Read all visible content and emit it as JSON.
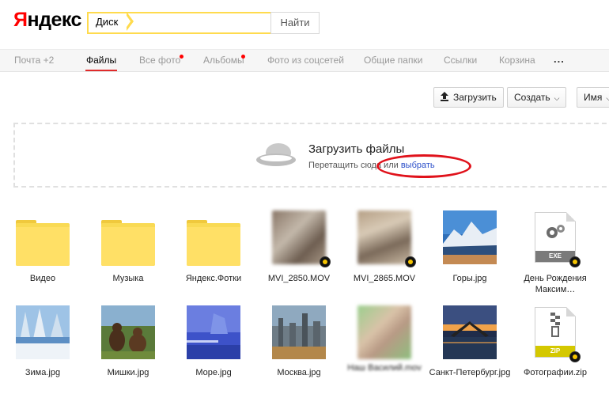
{
  "header": {
    "logo": "Яндекс",
    "search_tag": "Диск",
    "search_value": "",
    "search_button": "Найти"
  },
  "nav": {
    "items": [
      {
        "label": "Почта +2",
        "active": false,
        "dot": false
      },
      {
        "label": "Файлы",
        "active": true,
        "dot": false
      },
      {
        "label": "Все фото",
        "active": false,
        "dot": true
      },
      {
        "label": "Альбомы",
        "active": false,
        "dot": true
      },
      {
        "label": "Фото из соцсетей",
        "active": false,
        "dot": false
      },
      {
        "label": "Общие папки",
        "active": false,
        "dot": false
      },
      {
        "label": "Ссылки",
        "active": false,
        "dot": false
      },
      {
        "label": "Корзина",
        "active": false,
        "dot": false
      }
    ],
    "more": "..."
  },
  "toolbar": {
    "upload_label": "Загрузить",
    "create_label": "Создать",
    "sort_label": "Имя"
  },
  "dropzone": {
    "title": "Загрузить файлы",
    "subtitle_prefix": "Перетащить сюда или ",
    "choose_link": "выбрать"
  },
  "files": [
    {
      "name": "Видео",
      "type": "folder"
    },
    {
      "name": "Музыка",
      "type": "folder"
    },
    {
      "name": "Яндекс.Фотки",
      "type": "folder"
    },
    {
      "name": "MVI_2850.MOV",
      "type": "video"
    },
    {
      "name": "MVI_2865.MOV",
      "type": "video"
    },
    {
      "name": "Горы.jpg",
      "type": "image"
    },
    {
      "name": "День Рождения Максим…",
      "type": "exe"
    },
    {
      "name": "Зима.jpg",
      "type": "image"
    },
    {
      "name": "Мишки.jpg",
      "type": "image"
    },
    {
      "name": "Море.jpg",
      "type": "image"
    },
    {
      "name": "Москва.jpg",
      "type": "image"
    },
    {
      "name": "Наш Василий.mov",
      "type": "video"
    },
    {
      "name": "Санкт-Петербург.jpg",
      "type": "image"
    },
    {
      "name": "Фотографии.zip",
      "type": "zip"
    }
  ],
  "colors": {
    "logo_red": "#ff0000",
    "search_border": "#ffdb4d",
    "active_tab_underline": "#e02b2b",
    "link_blue": "#2a4ec9",
    "highlight_oval": "#e0121b",
    "folder_yellow": "#ffe066"
  }
}
